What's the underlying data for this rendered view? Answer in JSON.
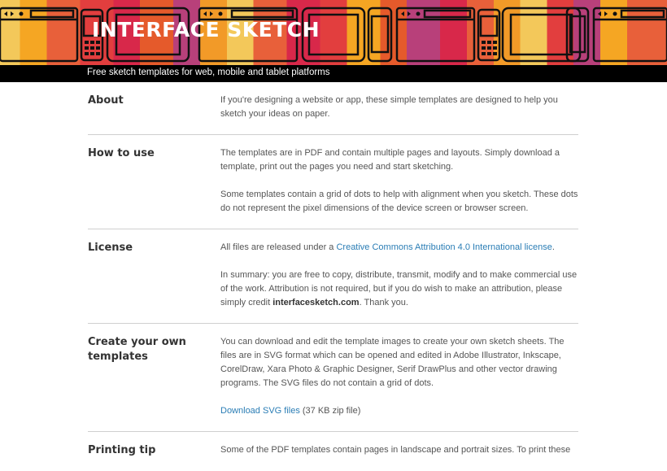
{
  "header": {
    "brand": "INTERFACE SKETCH",
    "tagline": "Free sketch templates for web, mobile and tablet platforms"
  },
  "sections": {
    "about": {
      "title": "About",
      "p1": "If you're designing a website or app, these simple templates are designed to help you sketch your ideas on paper."
    },
    "how_to_use": {
      "title": "How to use",
      "p1": "The templates are in PDF and contain multiple pages and layouts. Simply download a template, print out the pages you need and start sketching.",
      "p2": "Some templates contain a grid of dots to help with alignment when you sketch. These dots do not represent the pixel dimensions of the device screen or browser screen."
    },
    "license": {
      "title": "License",
      "p1_pre": "All files are released under a ",
      "p1_link": "Creative Commons Attribution 4.0 International license",
      "p1_post": ".",
      "p2_pre": "In summary: you are free to copy, distribute, transmit, modify and to make commercial use of the work. Attribution is not required, but if you do wish to make an attribution, please simply credit ",
      "p2_bold": "interfacesketch.com",
      "p2_post": ". Thank you."
    },
    "create": {
      "title": "Create your own templates",
      "p1": "You can download and edit the template images to create your own sketch sheets. The files are in SVG format which can be opened and edited in Adobe Illustrator, Inkscape, CorelDraw, Xara Photo & Graphic Designer, Serif DrawPlus and other vector drawing programs. The SVG files do not contain a grid of dots.",
      "download_link": "Download SVG files",
      "download_note": " (37 KB zip file)"
    },
    "printing": {
      "title": "Printing tip",
      "p1": "Some of the PDF templates contain pages in landscape and portrait sizes. To print these"
    }
  },
  "colors": {
    "link": "#2a7db5",
    "tagline_bar": "#000000",
    "divider": "#cfcfcf"
  },
  "icons": [
    "browser-window-icon",
    "tablet-icon",
    "phone-icon"
  ]
}
